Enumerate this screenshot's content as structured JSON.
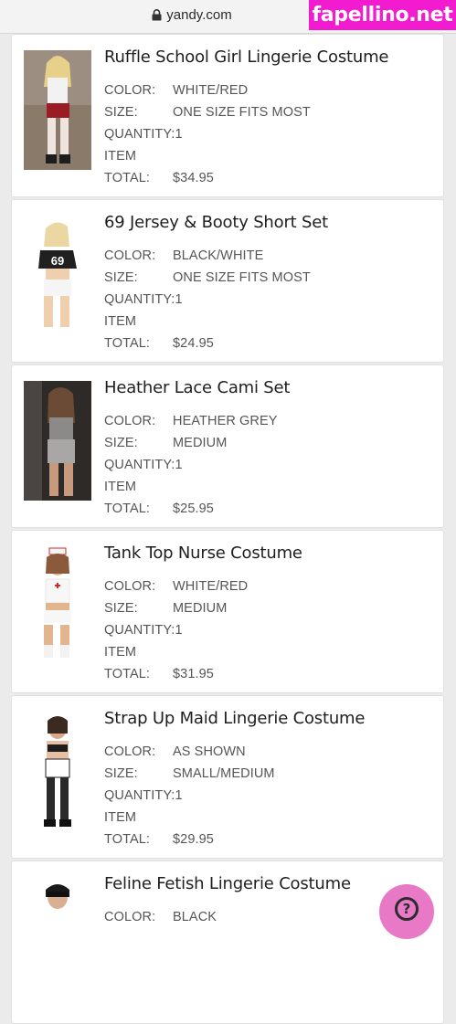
{
  "browser": {
    "url": "yandy.com"
  },
  "watermark": "fapellino.net",
  "labels": {
    "color": "COLOR:",
    "size": "SIZE:",
    "quantity": "QUANTITY:",
    "item": "ITEM",
    "total": "TOTAL:"
  },
  "items": [
    {
      "title": "Ruffle School Girl Lingerie Costume",
      "color": "WHITE/RED",
      "size": "ONE SIZE FITS MOST",
      "quantity": "1",
      "total": "$34.95"
    },
    {
      "title": "69 Jersey & Booty Short Set",
      "color": "BLACK/WHITE",
      "size": "ONE SIZE FITS MOST",
      "quantity": "1",
      "total": "$24.95",
      "jersey_number": "69"
    },
    {
      "title": "Heather Lace Cami Set",
      "color": "HEATHER GREY",
      "size": "MEDIUM",
      "quantity": "1",
      "total": "$25.95"
    },
    {
      "title": "Tank Top Nurse Costume",
      "color": "WHITE/RED",
      "size": "MEDIUM",
      "quantity": "1",
      "total": "$31.95"
    },
    {
      "title": "Strap Up Maid Lingerie Costume",
      "color": "AS SHOWN",
      "size": "SMALL/MEDIUM",
      "quantity": "1",
      "total": "$29.95"
    },
    {
      "title": "Feline Fetish Lingerie Costume",
      "color": "BLACK",
      "size": "",
      "quantity": "",
      "total": ""
    }
  ],
  "help_button": {
    "icon": "question-icon",
    "glyph": "?"
  },
  "colors": {
    "watermark_bg": "#f21bd0",
    "help_bg": "#e879c6",
    "card_bg": "#ffffff",
    "page_bg": "#ebebeb"
  }
}
